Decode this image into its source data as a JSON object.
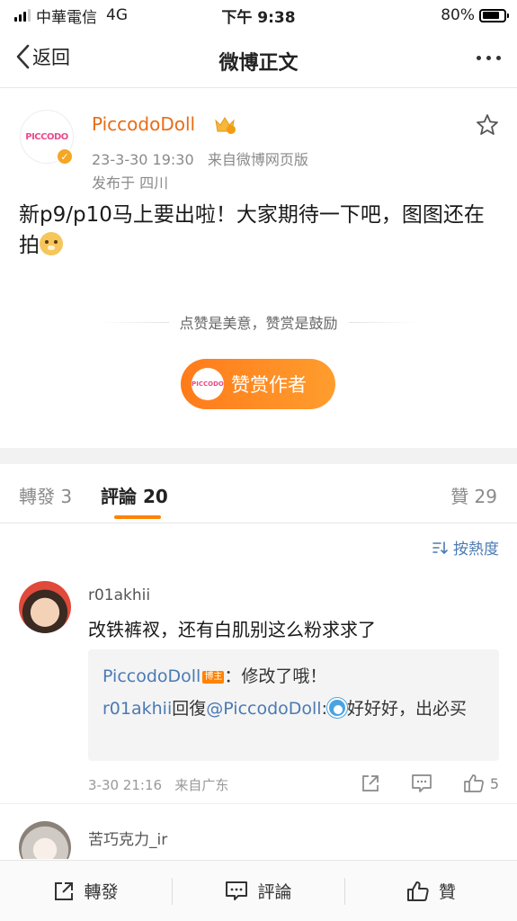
{
  "status_bar": {
    "carrier": "中華電信",
    "network": "4G",
    "time": "下午 9:38",
    "battery_percent": "80%",
    "battery_level": 0.8
  },
  "nav": {
    "back_label": "返回",
    "title": "微博正文"
  },
  "post": {
    "author": "PiccodoDoll",
    "avatar_logo_text": "PICCODO",
    "timestamp": "23-3-30 19:30",
    "source": "来自微博网页版",
    "location": "发布于 四川",
    "text": "新p9/p10马上要出啦！大家期待一下吧，图图还在拍",
    "reward_tagline": "点赞是美意，赞赏是鼓励",
    "reward_button": "赞赏作者"
  },
  "tabs": {
    "reposts_label": "轉發",
    "reposts_count": "3",
    "comments_label": "評論",
    "comments_count": "20",
    "likes_label": "贊",
    "likes_count": "29"
  },
  "sort": {
    "label": "按熱度"
  },
  "comments": [
    {
      "user": "r01akhii",
      "text": "改铁裤衩，还有白肌别这么粉求求了",
      "reply_author": "PiccodoDoll",
      "reply_badge": "博主",
      "reply_text": "：修改了哦！",
      "thread_user": "r01akhii",
      "thread_verb": "回復",
      "thread_mention": "@PiccodoDoll",
      "thread_text_after": "好好好，出必买",
      "time": "3-30 21:16",
      "source": "来自广东",
      "likes": "5"
    },
    {
      "user": "苦巧克力_ir"
    }
  ],
  "bottom_bar": {
    "repost": "轉發",
    "comment": "評論",
    "like": "贊"
  },
  "colors": {
    "accent": "#ff8200",
    "author_orange": "#e86c15",
    "link_blue": "#4b7ab3"
  }
}
